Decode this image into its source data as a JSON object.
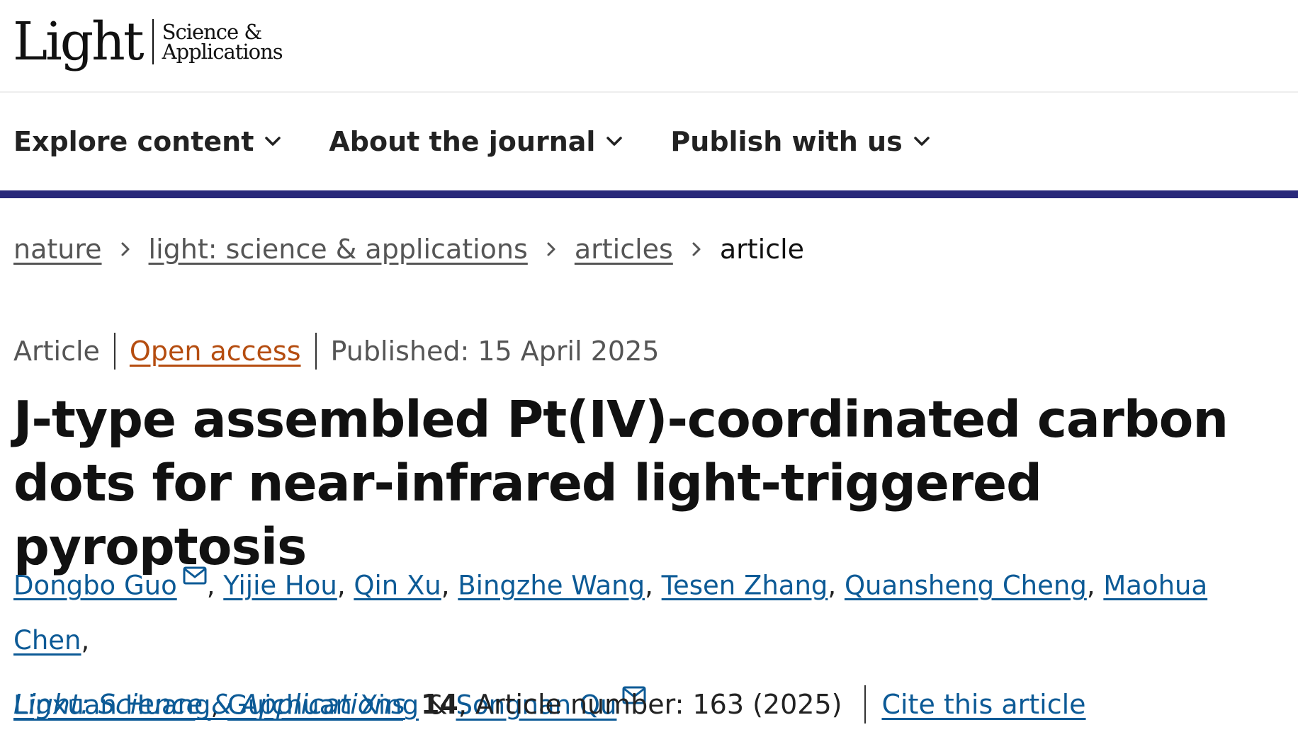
{
  "logo": {
    "main": "Light",
    "sub_line1": "Science &",
    "sub_line2": "Applications"
  },
  "nav": {
    "items": [
      {
        "label": "Explore content",
        "icon": "chevron-down-icon"
      },
      {
        "label": "About the journal",
        "icon": "chevron-down-icon"
      },
      {
        "label": "Publish with us",
        "icon": "chevron-down-icon"
      }
    ]
  },
  "breadcrumb": {
    "items": [
      "nature",
      "light: science & applications",
      "articles"
    ],
    "current": "article",
    "separator_icon": "chevron-right-icon"
  },
  "article_meta": {
    "type": "Article",
    "access": "Open access",
    "published": "Published: 15 April 2025"
  },
  "title": "J-type assembled Pt(IV)-coordinated carbon dots for near-infrared light-triggered pyroptosis",
  "authors": [
    {
      "name": "Dongbo Guo",
      "corresponding": true
    },
    {
      "name": "Yijie Hou",
      "corresponding": false
    },
    {
      "name": "Qin Xu",
      "corresponding": false
    },
    {
      "name": "Bingzhe Wang",
      "corresponding": false
    },
    {
      "name": "Tesen Zhang",
      "corresponding": false
    },
    {
      "name": "Quansheng Cheng",
      "corresponding": false
    },
    {
      "name": "Maohua Chen",
      "corresponding": false
    },
    {
      "name": "Linxuan Huang",
      "corresponding": false
    },
    {
      "name": "Guichuan Xing",
      "corresponding": false
    },
    {
      "name": "Songnan Qu",
      "corresponding": true
    }
  ],
  "author_punct": {
    "comma": ",",
    "ampersand": "&"
  },
  "citation": {
    "journal": "Light: Science & Applications",
    "volume": "14",
    "article_number": ", Article number: 163 (2025)",
    "cite_label": "Cite this article"
  },
  "colors": {
    "accent_bar": "#29297a",
    "link": "#0c5a96",
    "open_access": "#b54d10"
  }
}
